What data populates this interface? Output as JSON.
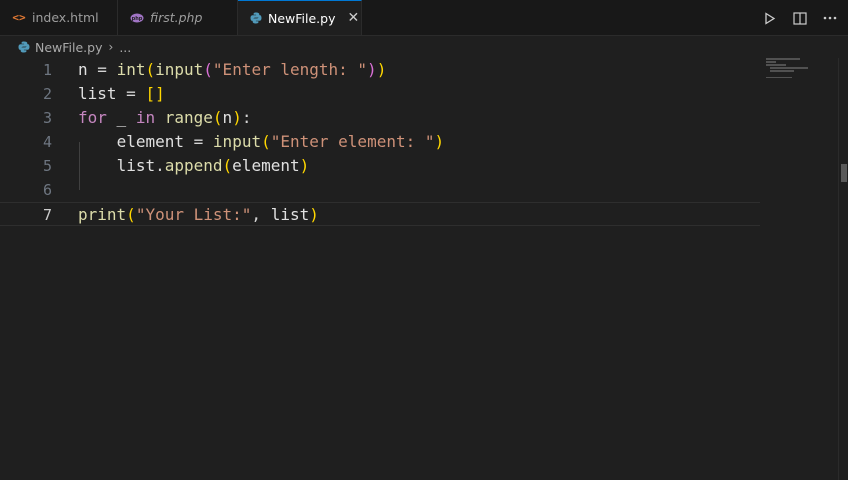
{
  "tabs": [
    {
      "label": "index.html",
      "icon": "html-icon",
      "icon_glyph": "<>",
      "active": false,
      "italic": false
    },
    {
      "label": "first.php",
      "icon": "php-icon",
      "active": false,
      "italic": true
    },
    {
      "label": "NewFile.py",
      "icon": "python-icon",
      "active": true,
      "italic": false
    }
  ],
  "tab_close_glyph": "✕",
  "breadcrumb": {
    "file": "NewFile.py",
    "separator": "›",
    "more": "..."
  },
  "toolbar": {
    "run_icon": "play-icon",
    "split_icon": "split-editor-icon",
    "more_icon": "more-actions-icon"
  },
  "line_numbers": [
    "1",
    "2",
    "3",
    "4",
    "5",
    "6",
    "7"
  ],
  "current_line": 7,
  "code_lines": [
    "n = int(input(\"Enter length: \"))",
    "list = []",
    "for _ in range(n):",
    "    element = input(\"Enter element: \")",
    "    list.append(element)",
    "",
    "print(\"Your List:\", list)"
  ],
  "colors": {
    "background": "#1f1f1f",
    "tabbar": "#181818",
    "active_tab_accent": "#0078d4",
    "keyword": "#569cd6",
    "function": "#dcdcaa",
    "string": "#ce9178",
    "bracket_level1": "#ffd700",
    "bracket_level2": "#da70d6"
  }
}
